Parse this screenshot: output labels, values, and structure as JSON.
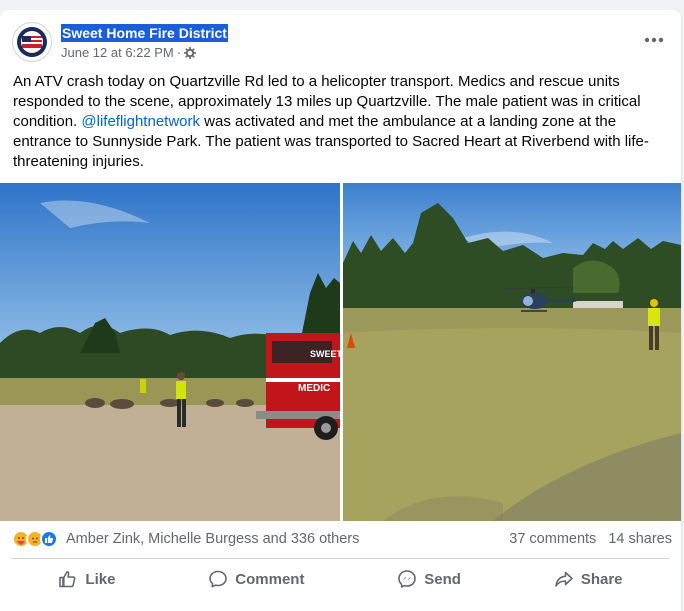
{
  "post": {
    "page_name": "Sweet Home Fire District",
    "date": "June 12 at 6:22 PM",
    "separator": "·",
    "text_part1": "An ATV crash today on Quartzville Rd led to a helicopter transport. Medics and rescue units responded to the scene, approximately 13 miles up Quartzville. The male patient was in critical condition. ",
    "mention": "@lifeflightnetwork",
    "text_part2": " was activated and met the ambulance at a landing zone at the entrance to Sunnyside Park. The patient was transported to Sacred Heart at Riverbend with life-threatening injuries.",
    "ambulance_label_top": "SWEET",
    "ambulance_label_side": "MEDIC"
  },
  "reactions": {
    "icons": [
      "care-icon",
      "sad-icon",
      "like-icon"
    ],
    "names": "Amber Zink, Michelle Burgess and 336 others",
    "comments": "37 comments",
    "shares": "14 shares"
  },
  "actions": {
    "like": "Like",
    "comment": "Comment",
    "send": "Send",
    "share": "Share"
  },
  "colors": {
    "page_name_highlight": "#1a5fd6",
    "mention": "#0064d1",
    "secondary_text": "#65676b"
  }
}
